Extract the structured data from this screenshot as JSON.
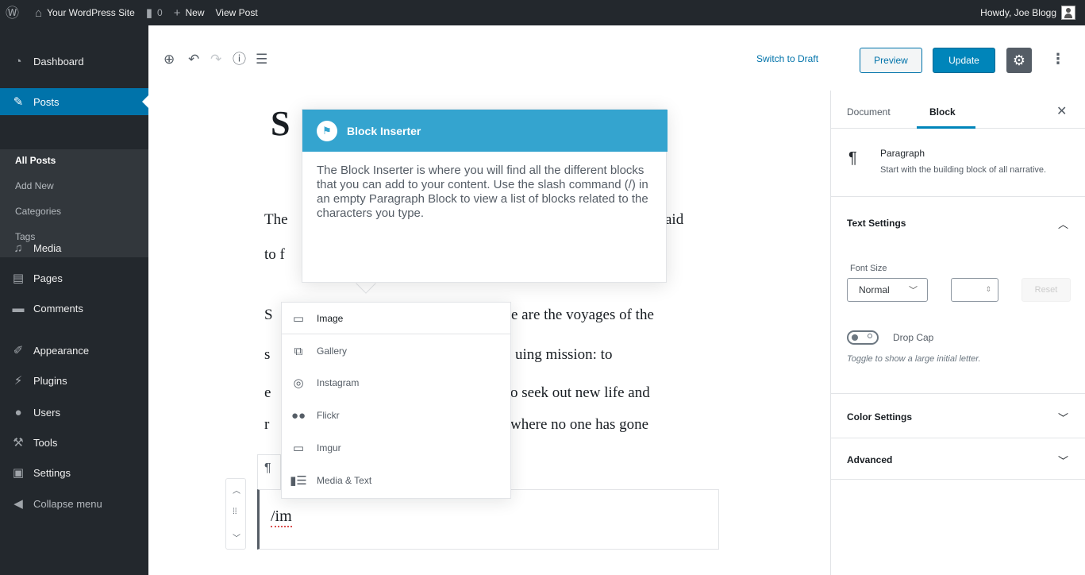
{
  "admin_bar": {
    "site_name": "Your WordPress Site",
    "comments_count": "0",
    "new_label": "New",
    "view_post_label": "View Post",
    "howdy": "Howdy, Joe Blogg"
  },
  "sidebar_menu": {
    "items": [
      {
        "label": "Dashboard",
        "icon": "dashboard-icon"
      },
      {
        "label": "Posts",
        "icon": "pin-icon"
      },
      {
        "label": "Media",
        "icon": "media-icon"
      },
      {
        "label": "Pages",
        "icon": "pages-icon"
      },
      {
        "label": "Comments",
        "icon": "comment-icon"
      },
      {
        "label": "Appearance",
        "icon": "brush-icon"
      },
      {
        "label": "Plugins",
        "icon": "plugin-icon"
      },
      {
        "label": "Users",
        "icon": "users-icon"
      },
      {
        "label": "Tools",
        "icon": "wrench-icon"
      },
      {
        "label": "Settings",
        "icon": "settings-icon"
      },
      {
        "label": "Collapse menu",
        "icon": "collapse-icon"
      }
    ],
    "submenu": [
      "All Posts",
      "Add New",
      "Categories",
      "Tags"
    ]
  },
  "toolbar": {
    "switch_to_draft": "Switch to Draft",
    "preview": "Preview",
    "update": "Update"
  },
  "settings_sidebar": {
    "tab_document": "Document",
    "tab_block": "Block",
    "block_name": "Paragraph",
    "block_description": "Start with the building block of all narrative.",
    "text_settings": "Text Settings",
    "font_size_label": "Font Size",
    "font_size_value": "Normal",
    "reset": "Reset",
    "drop_cap_label": "Drop Cap",
    "drop_cap_help": "Toggle to show a large initial letter.",
    "color_settings": "Color Settings",
    "advanced": "Advanced"
  },
  "content": {
    "title_fragment": "S",
    "p1_line1_start": "The",
    "p1_line1_end": "aid",
    "p1_line2_start": "to f",
    "p2_line1_start": "S",
    "p2_line1_end": "e are the voyages of the",
    "p2_line2_start": "s",
    "p2_line2_end": "uing mission: to",
    "p2_line3_start": "e",
    "p2_line3_end": "o seek out new life  and",
    "p2_line4_start": "r",
    "p2_line4_end": "where no one has gone",
    "slash_command": "/im"
  },
  "autocomplete": {
    "items": [
      {
        "label": "Image",
        "icon": "image-icon"
      },
      {
        "label": "Gallery",
        "icon": "gallery-icon"
      },
      {
        "label": "Instagram",
        "icon": "instagram-icon"
      },
      {
        "label": "Flickr",
        "icon": "flickr-icon"
      },
      {
        "label": "Imgur",
        "icon": "imgur-icon"
      },
      {
        "label": "Media & Text",
        "icon": "media-text-icon"
      }
    ]
  },
  "tip": {
    "title": "Block Inserter",
    "body": "The Block Inserter is where you will find all the different blocks that you can add to your content. Use the slash command (/) in an empty Paragraph Block to view a list of blocks related to the characters you type."
  },
  "colors": {
    "admin_dark": "#23282d",
    "accent_blue": "#0073aa",
    "tip_header": "#34a4cf",
    "update_button": "#0085ba"
  }
}
